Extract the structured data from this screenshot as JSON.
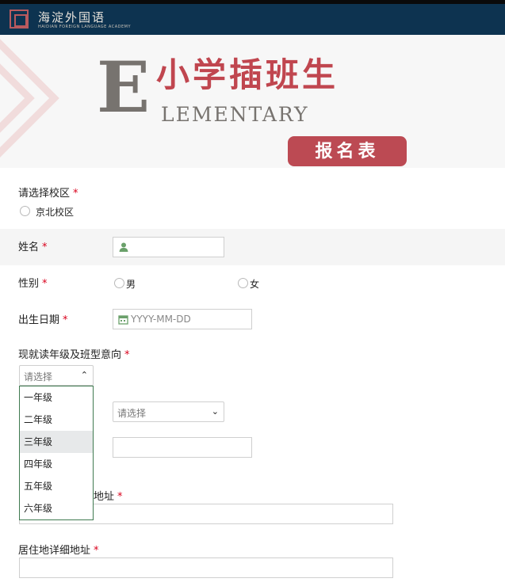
{
  "header": {
    "logo_name": "海淀外国语",
    "logo_sub": "HAIDIAN FOREIGN LANGUAGE ACADEMY"
  },
  "banner": {
    "big_letter": "E",
    "title_cn": "小学插班生",
    "title_en": "LEMENTARY",
    "badge": "报名表"
  },
  "colors": {
    "header_bg": "#0d3350",
    "accent_red": "#bc4a53",
    "required": "#d9001b",
    "dropdown_border": "#3f7a50"
  },
  "form": {
    "campus": {
      "label": "请选择校区",
      "required_mark": "*",
      "options": [
        "京北校区"
      ]
    },
    "name": {
      "label": "姓名",
      "required_mark": "*",
      "icon": "user-icon",
      "value": ""
    },
    "gender": {
      "label": "性别",
      "required_mark": "*",
      "options": [
        "男",
        "女"
      ]
    },
    "birthdate": {
      "label": "出生日期",
      "required_mark": "*",
      "icon": "calendar-icon",
      "placeholder": "YYYY-MM-DD"
    },
    "grade": {
      "label": "现就读年级及班型意向",
      "required_mark": "*",
      "selected": "请选择",
      "caret": "⌃",
      "options": [
        "一年级",
        "二年级",
        "三年级",
        "四年级",
        "五年级",
        "六年级"
      ],
      "hovered_option": "三年级"
    },
    "second_select": {
      "selected": "请选择",
      "caret": "⌄"
    },
    "hidden_field": {
      "value": ""
    },
    "household_address": {
      "label_visible_tail": "地址",
      "required_mark": "*",
      "value": ""
    },
    "residence_address": {
      "label": "居住地详细地址",
      "required_mark": "*",
      "value": ""
    }
  }
}
